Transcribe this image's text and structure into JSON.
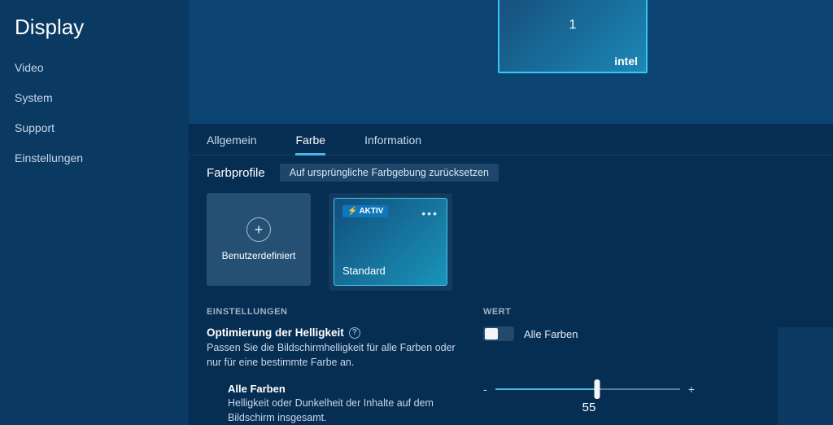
{
  "sidebar": {
    "title": "Display",
    "items": [
      "Video",
      "System",
      "Support",
      "Einstellungen"
    ]
  },
  "monitor": {
    "number": "1",
    "brand": "intel"
  },
  "tabs": [
    "Allgemein",
    "Farbe",
    "Information"
  ],
  "active_tab_index": 1,
  "profiles": {
    "label": "Farbprofile",
    "reset": "Auf ursprüngliche Farbgebung zurücksetzen",
    "custom_label": "Benutzerdefiniert",
    "active_badge": "AKTIV",
    "active_name": "Standard"
  },
  "columns": {
    "settings": "EINSTELLUNGEN",
    "value": "WERT"
  },
  "brightness": {
    "title": "Optimierung der Helligkeit",
    "desc": "Passen Sie die Bildschirmhelligkeit für alle Farben oder nur für eine bestimmte Farbe an.",
    "toggle_label": "Alle Farben",
    "sub_title": "Alle Farben",
    "sub_desc": "Helligkeit oder Dunkelheit der Inhalte auf dem Bildschirm insgesamt.",
    "value": "55",
    "minus": "-",
    "plus": "+"
  }
}
